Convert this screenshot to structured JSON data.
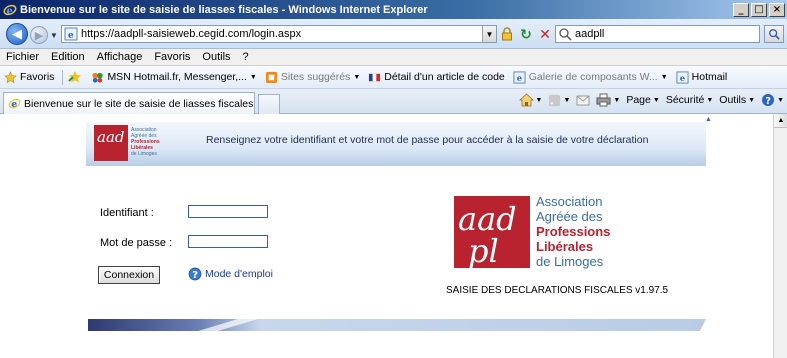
{
  "window": {
    "title": "Bienvenue sur le site de saisie de liasses fiscales - Windows Internet Explorer",
    "buttons": [
      "_",
      "□",
      "×"
    ]
  },
  "address": {
    "url": "https://aadpll-saisieweb.cegid.com/login.aspx",
    "search_value": "aadpll"
  },
  "menu": [
    "Fichier",
    "Edition",
    "Affichage",
    "Favoris",
    "Outils",
    "?"
  ],
  "favorites": {
    "label": "Favoris",
    "items": [
      {
        "label": "MSN Hotmail.fr, Messenger,...",
        "dropdown": true,
        "muted": false
      },
      {
        "label": "Sites suggérés",
        "dropdown": true,
        "muted": true
      },
      {
        "label": "Détail d'un article de code",
        "dropdown": false,
        "muted": false
      },
      {
        "label": "Galerie de composants W...",
        "dropdown": true,
        "muted": true
      },
      {
        "label": "Hotmail",
        "dropdown": false,
        "muted": false
      }
    ]
  },
  "tabs": {
    "active_label": "Bienvenue sur le site de saisie de liasses fiscales"
  },
  "command_bar": {
    "page": "Page",
    "security": "Sécurité",
    "tools": "Outils"
  },
  "page": {
    "header_message": "Renseignez votre identifiant et votre mot de passe pour accéder à la saisie de votre déclaration",
    "logo_small": {
      "mark": "aad pl",
      "lines": [
        "Association",
        "Agréée des",
        "Professions",
        "Libérales",
        "de Limoges"
      ]
    },
    "logo_big": {
      "lines": [
        "Association",
        "Agréée des",
        "Professions",
        "Libérales",
        "de Limoges"
      ]
    },
    "form": {
      "identifiant_label": "Identifiant :",
      "identifiant_value": "",
      "password_label": "Mot de passe :",
      "password_value": "",
      "submit_label": "Connexion",
      "help_label": "Mode d'emploi"
    },
    "version_text": "SAISIE DES DECLARATIONS FISCALES v1.97.5"
  },
  "colors": {
    "brand_red": "#b8232f",
    "brand_blue": "#3a6ea5",
    "footer_dark": "#33417a"
  }
}
